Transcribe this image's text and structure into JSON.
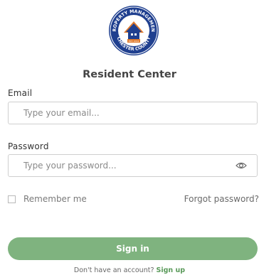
{
  "logo": {
    "text_top": "PROPERTY MANAGEMENT",
    "text_bottom": "CHESTER COUNTY",
    "text_center": "EST. 2012"
  },
  "title": "Resident Center",
  "email": {
    "label": "Email",
    "placeholder": "Type your email...",
    "value": ""
  },
  "password": {
    "label": "Password",
    "placeholder": "Type your password...",
    "value": ""
  },
  "remember_label": "Remember me",
  "remember_checked": false,
  "forgot_label": "Forgot password?",
  "signin_label": "Sign in",
  "signup_prompt": "Don't have an account?",
  "signup_link": "Sign up",
  "colors": {
    "accent": "#7fb37f",
    "link": "#5a9a5a",
    "logo_blue": "#1f3f8f",
    "logo_orange": "#e07a2c"
  }
}
